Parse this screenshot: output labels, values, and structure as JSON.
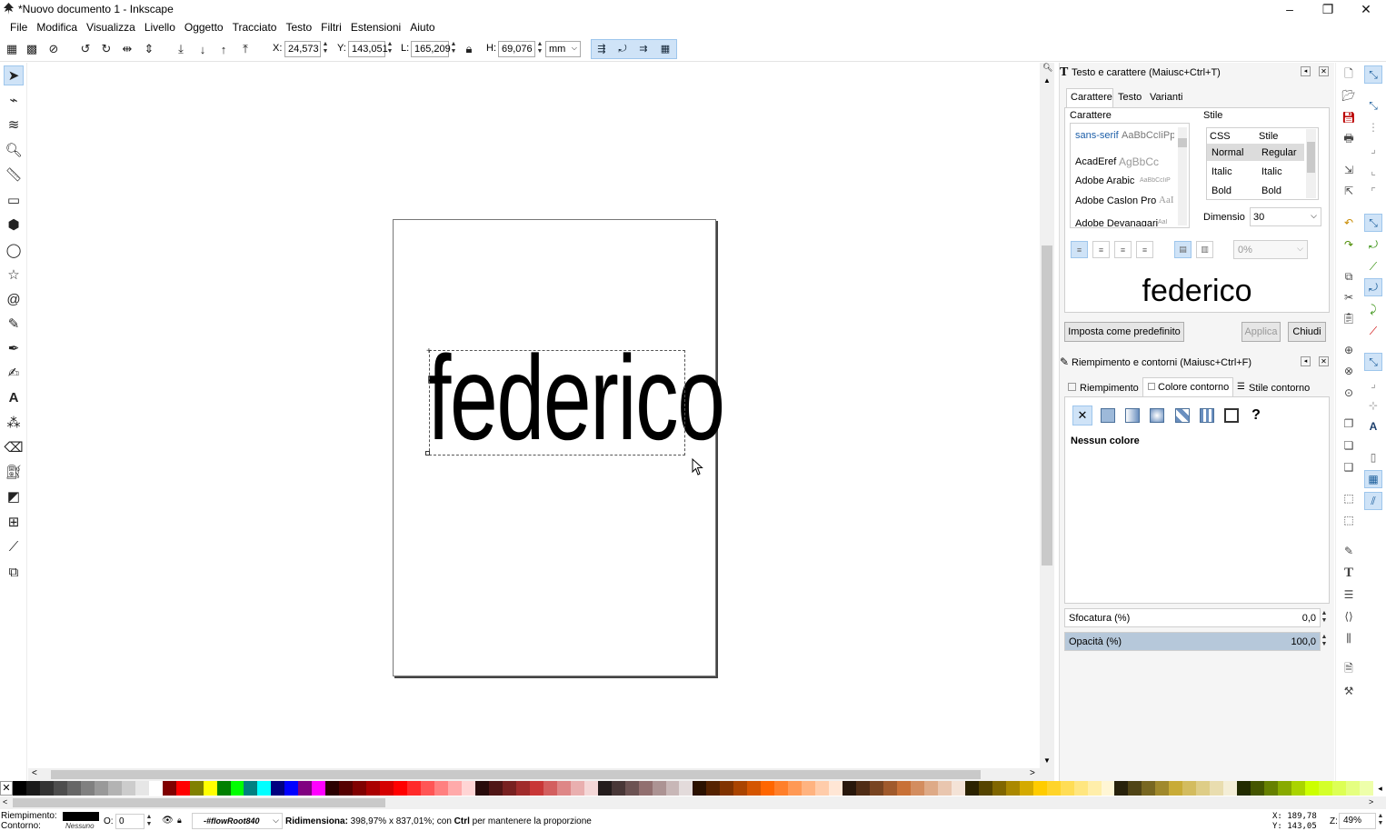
{
  "window": {
    "title": "*Nuovo documento 1 - Inkscape",
    "controls": {
      "minimize": "–",
      "maximize": "❐",
      "close": "✕"
    }
  },
  "menu": [
    "File",
    "Modifica",
    "Visualizza",
    "Livello",
    "Oggetto",
    "Tracciato",
    "Testo",
    "Filtri",
    "Estensioni",
    "Aiuto"
  ],
  "toolbar": {
    "x_label": "X:",
    "x_value": "24,573",
    "y_label": "Y:",
    "y_value": "143,051",
    "w_label": "L:",
    "w_value": "165,209",
    "h_label": "H:",
    "h_value": "69,076",
    "unit": "mm"
  },
  "canvas": {
    "text": "federico"
  },
  "text_panel": {
    "title": "Testo e carattere (Maiusc+Ctrl+T)",
    "tabs": [
      "Carattere",
      "Testo",
      "Varianti"
    ],
    "font_group_label": "Carattere",
    "fonts": [
      {
        "name": "sans-serif",
        "preview": "AaBbCcIiPp"
      },
      {
        "name": "AcadEref",
        "preview": "AgBbCc"
      },
      {
        "name": "Adobe Arabic",
        "preview": "AaBbCcIiP"
      },
      {
        "name": "Adobe Caslon Pro",
        "preview": "AaI"
      },
      {
        "name": "Adobe Devanagari",
        "preview": "AaI"
      }
    ],
    "style_group_label": "Stile",
    "style_headers": [
      "CSS",
      "Stile"
    ],
    "styles": [
      {
        "css": "Normal",
        "name": "Regular"
      },
      {
        "css": "Italic",
        "name": "Italic"
      },
      {
        "css": "Bold",
        "name": "Bold"
      }
    ],
    "size_label": "Dimensio",
    "size_value": "30",
    "spacing_value": "0%",
    "preview_text": "federico",
    "btn_default": "Imposta come predefinito",
    "btn_apply": "Applica",
    "btn_close": "Chiudi"
  },
  "fill_panel": {
    "title": "Riempimento e contorni (Maiusc+Ctrl+F)",
    "tabs": [
      "Riempimento",
      "Colore contorno",
      "Stile contorno"
    ],
    "unknown_symbol": "?",
    "none_label": "Nessun colore",
    "blur_label": "Sfocatura (%)",
    "blur_value": "0,0",
    "opacity_label": "Opacità (%)",
    "opacity_value": "100,0",
    "opacity_fraction": 1.0
  },
  "status": {
    "fill_label": "Riempimento:",
    "stroke_label": "Contorno:",
    "stroke_value": "Nessuno",
    "opacity_label": "O:",
    "opacity_value": "0",
    "layer": "-#flowRoot840",
    "message_bold": "Ridimensiona:",
    "message_rest": " 398,97% x 837,01%; con ",
    "message_ctrl": "Ctrl",
    "message_tail": " per mantenere la proporzione",
    "x_coord": "X: 189,78",
    "y_coord": "Y: 143,05",
    "zoom_label": "Z:",
    "zoom_value": "49%"
  },
  "palette": [
    "#000000",
    "#1a1a1a",
    "#333333",
    "#4d4d4d",
    "#666666",
    "#808080",
    "#999999",
    "#b3b3b3",
    "#cccccc",
    "#e6e6e6",
    "#ffffff",
    "#800000",
    "#ff0000",
    "#808000",
    "#ffff00",
    "#008000",
    "#00ff00",
    "#008080",
    "#00ffff",
    "#000080",
    "#0000ff",
    "#800080",
    "#ff00ff",
    "#2b0000",
    "#550000",
    "#800000",
    "#aa0000",
    "#d40000",
    "#ff0000",
    "#ff2a2a",
    "#ff5555",
    "#ff8080",
    "#ffaaaa",
    "#ffd5d5",
    "#280b0b",
    "#501616",
    "#782121",
    "#a02c2c",
    "#c83737",
    "#d35f5f",
    "#de8787",
    "#e9afaf",
    "#f4d7d7",
    "#241c1c",
    "#483737",
    "#6c5353",
    "#916f6f",
    "#ac9393",
    "#c8b7b7",
    "#e3dbdb",
    "#2b1100",
    "#552200",
    "#803300",
    "#aa4400",
    "#d45500",
    "#ff6600",
    "#ff7f2a",
    "#ff9955",
    "#ffb380",
    "#ffccaa",
    "#ffe6d5",
    "#28170b",
    "#502d16",
    "#784421",
    "#a05a2c",
    "#c87137",
    "#d38d5f",
    "#deaa87",
    "#e9c6af",
    "#f4e3d7",
    "#2b2200",
    "#554400",
    "#806600",
    "#aa8800",
    "#d4aa00",
    "#ffcc00",
    "#ffd42a",
    "#ffdd55",
    "#ffe680",
    "#ffeeaa",
    "#fff6d5",
    "#28220b",
    "#504416",
    "#786721",
    "#a0892c",
    "#c8ab37",
    "#d3bc5f",
    "#decd87",
    "#e9ddaf",
    "#f4eed7",
    "#222b00",
    "#445500",
    "#668000",
    "#88aa00",
    "#aad400",
    "#ccff00",
    "#d4ff2a",
    "#ddff55",
    "#e5ff80",
    "#eeffaa"
  ]
}
